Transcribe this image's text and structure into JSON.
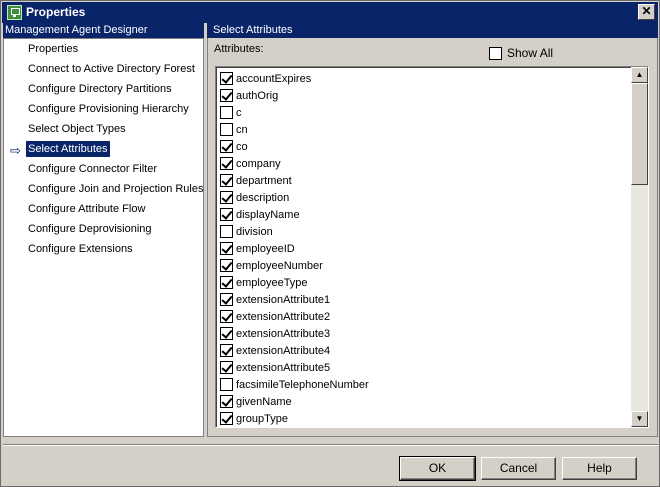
{
  "window": {
    "title": "Properties",
    "close_glyph": "✕"
  },
  "left": {
    "header": "Management Agent Designer",
    "selected_arrow": "⇨",
    "items": [
      {
        "label": "Properties"
      },
      {
        "label": "Connect to Active Directory Forest"
      },
      {
        "label": "Configure Directory Partitions"
      },
      {
        "label": "Configure Provisioning Hierarchy"
      },
      {
        "label": "Select Object Types"
      },
      {
        "label": "Select Attributes",
        "selected": true
      },
      {
        "label": "Configure Connector Filter"
      },
      {
        "label": "Configure Join and Projection Rules"
      },
      {
        "label": "Configure Attribute Flow"
      },
      {
        "label": "Configure Deprovisioning"
      },
      {
        "label": "Configure Extensions"
      }
    ]
  },
  "right": {
    "header": "Select Attributes",
    "attributes_label": "Attributes:",
    "show_all": {
      "label": "Show All",
      "checked": false
    },
    "attributes": [
      {
        "name": "accountExpires",
        "checked": true
      },
      {
        "name": "authOrig",
        "checked": true
      },
      {
        "name": "c",
        "checked": false
      },
      {
        "name": "cn",
        "checked": false
      },
      {
        "name": "co",
        "checked": true
      },
      {
        "name": "company",
        "checked": true
      },
      {
        "name": "department",
        "checked": true
      },
      {
        "name": "description",
        "checked": true
      },
      {
        "name": "displayName",
        "checked": true
      },
      {
        "name": "division",
        "checked": false
      },
      {
        "name": "employeeID",
        "checked": true
      },
      {
        "name": "employeeNumber",
        "checked": true
      },
      {
        "name": "employeeType",
        "checked": true
      },
      {
        "name": "extensionAttribute1",
        "checked": true
      },
      {
        "name": "extensionAttribute2",
        "checked": true
      },
      {
        "name": "extensionAttribute3",
        "checked": true
      },
      {
        "name": "extensionAttribute4",
        "checked": true
      },
      {
        "name": "extensionAttribute5",
        "checked": true
      },
      {
        "name": "facsimileTelephoneNumber",
        "checked": false
      },
      {
        "name": "givenName",
        "checked": true
      },
      {
        "name": "groupType",
        "checked": true
      }
    ]
  },
  "buttons": {
    "ok": "OK",
    "cancel": "Cancel",
    "help": "Help"
  }
}
